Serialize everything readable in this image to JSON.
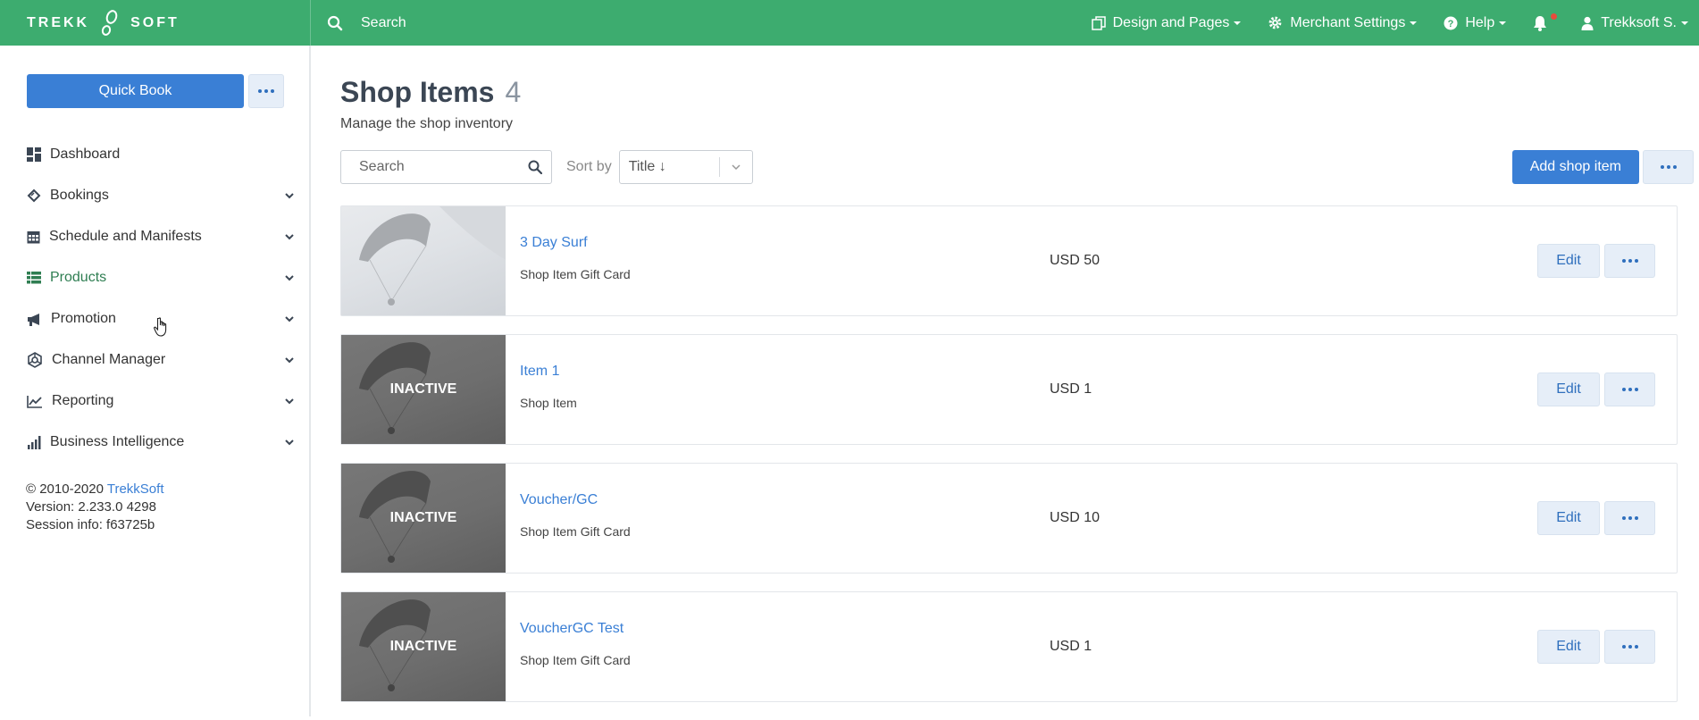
{
  "topbar": {
    "brand_left": "TREKK",
    "brand_right": "SOFT",
    "search_label": "Search",
    "design_pages": "Design and Pages",
    "merchant_settings": "Merchant Settings",
    "help": "Help",
    "user": "Trekksoft S."
  },
  "sidebar": {
    "quick_book": "Quick Book",
    "items": [
      {
        "label": "Dashboard",
        "icon": "dashboard-icon"
      },
      {
        "label": "Bookings",
        "icon": "ticket-icon"
      },
      {
        "label": "Schedule and Manifests",
        "icon": "calendar-icon"
      },
      {
        "label": "Products",
        "icon": "list-icon"
      },
      {
        "label": "Promotion",
        "icon": "megaphone-icon"
      },
      {
        "label": "Channel Manager",
        "icon": "channel-icon"
      },
      {
        "label": "Reporting",
        "icon": "line-chart-icon"
      },
      {
        "label": "Business Intelligence",
        "icon": "bar-chart-icon"
      }
    ],
    "footer": {
      "copyright": "© 2010-2020",
      "company": "TrekkSoft",
      "version": "Version: 2.233.0 4298",
      "session": "Session info: f63725b"
    }
  },
  "main": {
    "title": "Shop Items",
    "count": "4",
    "subtitle": "Manage the shop inventory",
    "search_placeholder": "Search",
    "sort_label": "Sort by",
    "sort_value": "Title ↓",
    "add_button": "Add shop item",
    "items": [
      {
        "title": "3 Day Surf",
        "type": "Shop Item Gift Card",
        "price": "USD 50",
        "status": "",
        "edit": "Edit"
      },
      {
        "title": "Item 1",
        "type": "Shop Item",
        "price": "USD 1",
        "status": "INACTIVE",
        "edit": "Edit"
      },
      {
        "title": "Voucher/GC",
        "type": "Shop Item Gift Card",
        "price": "USD 10",
        "status": "INACTIVE",
        "edit": "Edit"
      },
      {
        "title": "VoucherGC Test",
        "type": "Shop Item Gift Card",
        "price": "USD 1",
        "status": "INACTIVE",
        "edit": "Edit"
      }
    ]
  },
  "colors": {
    "topbar": "#3dac6f",
    "primary": "#3a7fd5",
    "active_nav": "#2f7e52"
  }
}
